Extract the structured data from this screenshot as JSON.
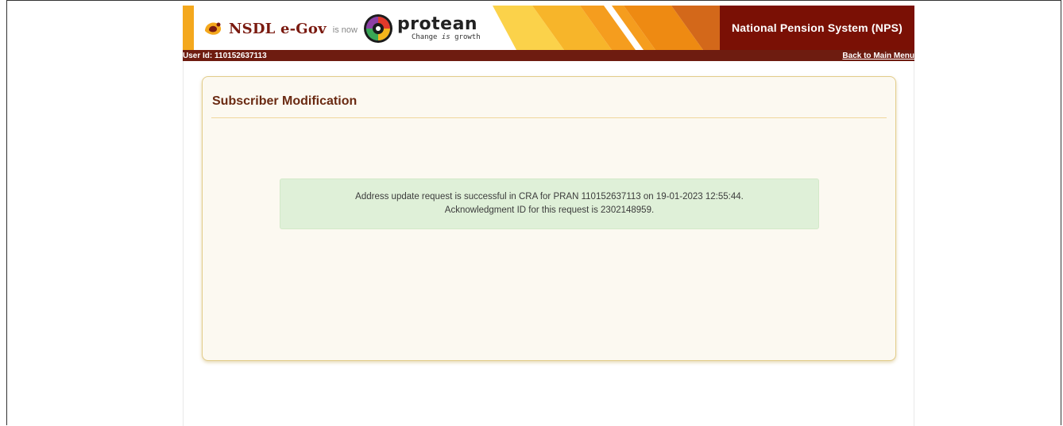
{
  "header": {
    "nsdl_brand": "NSDL e-Gov",
    "is_now": "is now",
    "protean_brand": "protean",
    "protean_tagline_pre": "Change ",
    "protean_tagline_em": "is",
    "protean_tagline_post": " growth",
    "system_title": "National Pension System (NPS)"
  },
  "userbar": {
    "user_id": "User Id: 110152637113",
    "back_link": "Back to Main Menu"
  },
  "card": {
    "title": "Subscriber Modification",
    "message_line1": "Address update request is successful in CRA for PRAN 110152637113 on  19-01-2023 12:55:44.",
    "message_line2": "Acknowledgment ID for this request is 2302148959."
  },
  "colors": {
    "brand_maroon": "#7a1005",
    "accent_orange": "#f4a81d",
    "success_bg": "#dff0d8",
    "card_bg": "#fcf9f1"
  }
}
